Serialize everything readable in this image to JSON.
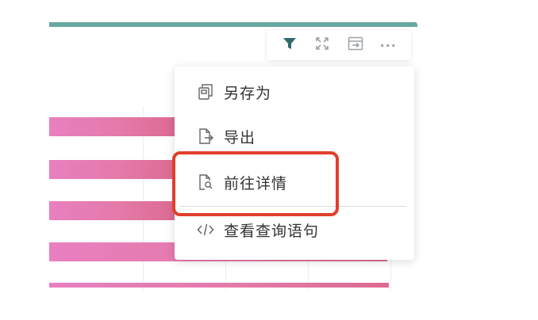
{
  "colors": {
    "accent_teal": "#68a8a0",
    "filter_icon": "#2e6b6e",
    "highlight_red": "#e03f2b",
    "bar_start": "#e97fc0",
    "bar_end": "#dd6a92"
  },
  "toolbar": {
    "icons": [
      "filter-icon",
      "fullscreen-icon",
      "export-view-icon",
      "more-icon"
    ],
    "more_label": "···"
  },
  "menu": {
    "items": [
      {
        "label": "另存为",
        "icon": "save-as-icon"
      },
      {
        "label": "导出",
        "icon": "export-icon"
      },
      {
        "label": "前往详情",
        "icon": "details-icon"
      },
      {
        "label": "查看查询语句",
        "icon": "code-icon"
      }
    ]
  },
  "chart_data": {
    "type": "bar",
    "orientation": "horizontal",
    "categories": [
      "",
      "",
      "",
      "",
      ""
    ],
    "values": [
      null,
      null,
      null,
      null,
      null
    ]
  }
}
